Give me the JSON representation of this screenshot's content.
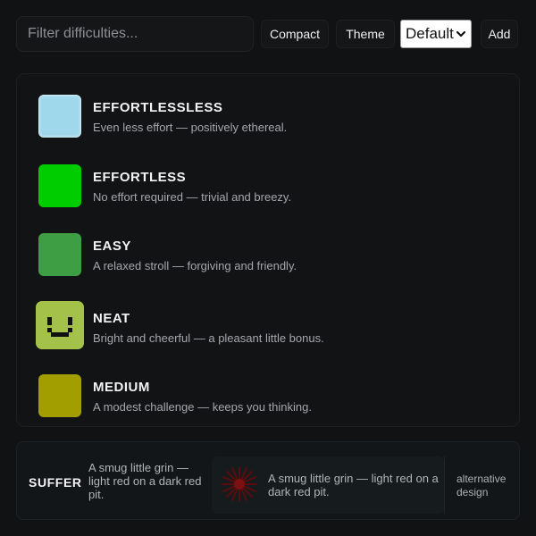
{
  "toolbar": {
    "filter_placeholder": "Filter difficulties...",
    "filter_value": "",
    "compact_label": "Compact",
    "theme_label": "Theme",
    "theme_selected": "Default",
    "add_label": "Add"
  },
  "difficulties": [
    {
      "title": "EFFORTLESSLESS",
      "description": "Even less effort — positively ethereal.",
      "color": "#9ed8ea",
      "icon": "pale-blue-square-icon"
    },
    {
      "title": "EFFORTLESS",
      "description": "No effort required — trivial and breezy.",
      "color": "#00cd00",
      "icon": "green-square-icon"
    },
    {
      "title": "EASY",
      "description": "A relaxed stroll — forgiving and friendly.",
      "color": "#3e9e44",
      "icon": "dark-green-square-icon"
    },
    {
      "title": "NEAT",
      "description": "Bright and cheerful — a pleasant little bonus.",
      "color": "#a4c24a",
      "icon": "smiley-face-icon"
    },
    {
      "title": "MEDIUM",
      "description": "A modest challenge — keeps you thinking.",
      "color": "#a39e00",
      "icon": "olive-square-icon"
    }
  ],
  "bottom": {
    "title": "SUFFER",
    "description": "A smug little grin — light red on a dark red pit.",
    "alt_description": "A smug little grin — light red on a dark red pit.",
    "alt_icon": "red-starburst-icon",
    "alt_color": "#9b1010",
    "note": "alternative design"
  }
}
